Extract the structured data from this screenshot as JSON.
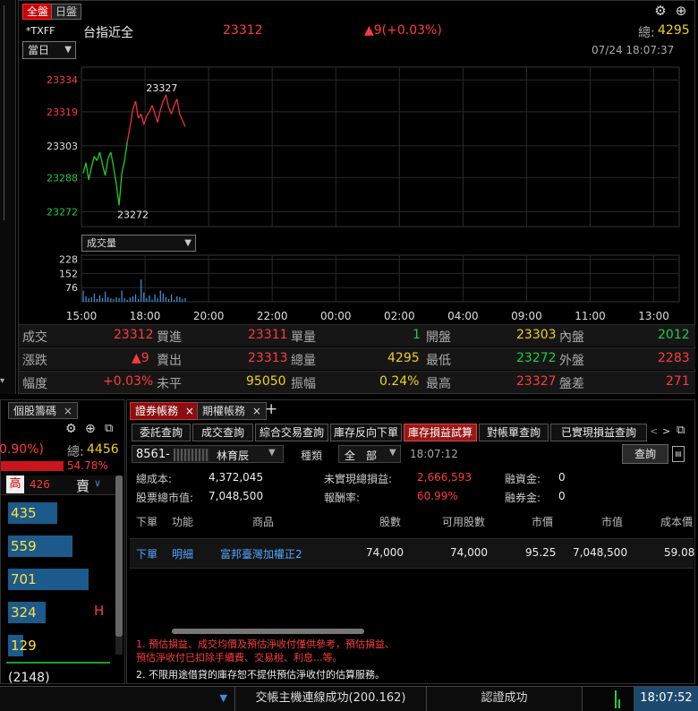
{
  "top_tabs": {
    "all": "全盤",
    "day": "日盤"
  },
  "quote_header": {
    "symbol": "*TXFF",
    "name": "台指近全",
    "price": "23312",
    "change": "▲9(+0.03%)",
    "total_label": "總:",
    "total_value": "4295",
    "period": "當日",
    "datetime": "07/24  18:07:37"
  },
  "chart_data": {
    "type": "line",
    "price_axis": {
      "ticks": [
        "23334",
        "23319",
        "23303",
        "23288",
        "23272"
      ],
      "ylim": [
        23265,
        23340
      ]
    },
    "annotations": {
      "high": "23327",
      "low": "23272"
    },
    "x_ticks": [
      "15:00",
      "18:00",
      "20:00",
      "22:00",
      "00:00",
      "02:00",
      "04:00",
      "09:00",
      "11:00",
      "13:00"
    ],
    "series": [
      {
        "values": [
          23290,
          23295,
          23287,
          23293,
          23298,
          23296,
          23300,
          23294,
          23289,
          23297,
          23300,
          23293,
          23285,
          23275,
          23290,
          23296,
          23305,
          23312,
          23320,
          23324,
          23316,
          23318,
          23313,
          23317,
          23319,
          23322,
          23318,
          23314,
          23320,
          23324,
          23327,
          23321,
          23318,
          23322,
          23325,
          23318,
          23315,
          23312
        ]
      }
    ],
    "volume_selector": "成交量",
    "volume_axis": {
      "ticks": [
        "228",
        "152",
        "76"
      ],
      "ylim": [
        0,
        250
      ]
    },
    "volume_values": [
      60,
      30,
      20,
      25,
      45,
      15,
      35,
      20,
      55,
      25,
      20,
      15,
      25,
      20,
      60,
      20,
      10,
      22,
      30,
      40,
      15,
      120,
      50,
      20,
      35,
      12,
      40,
      20,
      60,
      45,
      25,
      15,
      40,
      10,
      30,
      25,
      15,
      20
    ]
  },
  "quote_table": {
    "row1": {
      "l1": "成交",
      "v1": "23312",
      "l2": "買進",
      "v2": "23311",
      "l3": "單量",
      "v3": "1",
      "l4": "開盤",
      "v4": "23303",
      "l5": "內盤",
      "v5": "2012"
    },
    "row2": {
      "l1": "漲跌",
      "v1": "▲9",
      "l2": "賣出",
      "v2": "23313",
      "l3": "總量",
      "v3": "4295",
      "l4": "最低",
      "v4": "23272",
      "l5": "外盤",
      "v5": "2283"
    },
    "row3": {
      "l1": "幅度",
      "v1": "+0.03%",
      "l2": "未平",
      "v2": "95050",
      "l3": "振幅",
      "v3": "0.24%",
      "l4": "最高",
      "v4": "23327",
      "l5": "盤差",
      "v5": "271"
    }
  },
  "left_panel": {
    "tab": "個股籌碼",
    "pct": "0.90%)",
    "total_label": "總:",
    "total_value": "4456",
    "bar_pct": "54.78%",
    "high_label": "高",
    "high_value": "426",
    "sell_label": "賣",
    "bars": [
      "435",
      "559",
      "701",
      "324",
      "129"
    ],
    "bar_fill": [
      0.55,
      0.72,
      0.9,
      0.42,
      0.17
    ],
    "h_mark": "H",
    "bottom": "(2148)"
  },
  "account_panel": {
    "main_tabs": [
      "證券帳務",
      "期權帳務"
    ],
    "sub_tabs": [
      "委託查詢",
      "成交查詢",
      "綜合交易查詢",
      "庫存反向下單",
      "庫存損益試算",
      "對帳單查詢",
      "已實現損益查詢"
    ],
    "account_no": "8561-",
    "account_name": "林育辰",
    "type_label": "種類",
    "type_value": "全　部",
    "time": "18:07:12",
    "query_button": "查詢",
    "summary": {
      "cost_label": "總成本:",
      "cost_value": "4,372,045",
      "unreal_label": "未實現總損益:",
      "unreal_value": "2,666,593",
      "margin_label": "融資金:",
      "margin_value": "0",
      "mkt_label": "股票總市值:",
      "mkt_value": "7,048,500",
      "roi_label": "報酬率:",
      "roi_value": "60.99%",
      "short_label": "融券金:",
      "short_value": "0"
    },
    "columns": [
      "下單",
      "功能",
      "商品",
      "股數",
      "可用股數",
      "市價",
      "市值",
      "成本價"
    ],
    "rows": [
      {
        "order": "下單",
        "func": "明細",
        "product": "富邦臺灣加權正2",
        "shares": "74,000",
        "avail": "74,000",
        "price": "95.25",
        "value": "7,048,500",
        "cost": "59.08"
      }
    ],
    "notes": [
      "1. 預估損益、成交均價及預估淨收付僅供參考，預估損益、",
      "預估淨收付已扣除手續費、交易稅、利息...等。",
      "2. 不限用途借貸的庫存恕不提供預估淨收付的估算服務。"
    ]
  },
  "status_bar": {
    "connection": "交帳主機連線成功(200.162)",
    "auth": "認證成功",
    "clock": "18:07:52"
  }
}
